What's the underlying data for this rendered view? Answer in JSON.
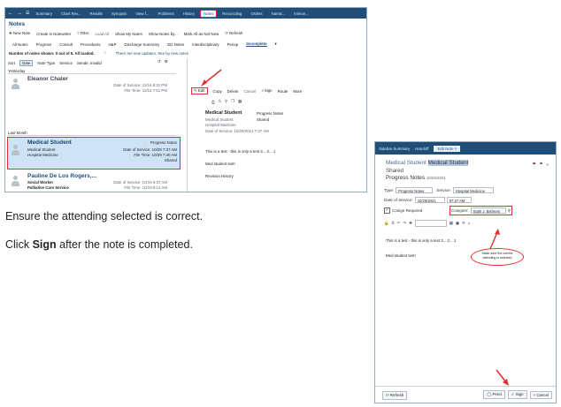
{
  "left_window": {
    "tabs": [
      "Summary",
      "Chart Rev...",
      "Results",
      "Synopsis",
      "View f...",
      "Problems",
      "History",
      "Notes",
      "Reconciling",
      "Orders",
      "Narrat...",
      "Immun..."
    ],
    "active_tab": "Notes",
    "title": "Notes",
    "toolbar": [
      "New Note",
      "Create in Notewriter",
      "Filter",
      "Load All",
      "Show My Notes",
      "Show Notes by...",
      "Mark All as Not New",
      "Refresh"
    ],
    "filter_tabs": [
      "All Notes",
      "Progress",
      "Consult",
      "Procedures",
      "H&P",
      "Discharge Summary",
      "ED Notes",
      "Interdisciplinary",
      "Periop",
      "Incomplete"
    ],
    "active_filter": "Incomplete",
    "status_text": "Number of notes shown: 0 out of 5.  All loaded.",
    "status_warning": "There are new updates. See by new notes",
    "sort_options": [
      "Sort",
      "Date",
      "Note Type",
      "Service",
      "Sende, Invalid"
    ],
    "groups": [
      "Yesterday",
      "Last Month"
    ],
    "notes": [
      {
        "name": "Eleanor Chaler",
        "role": "",
        "dept": "",
        "date_of_service": "Date of Service: 11/16 8:31 PM",
        "file_time": "File Time: 11/16 7:51 PM",
        "type": "",
        "status": ""
      },
      {
        "name": "Medical Student",
        "role": "Medical Student",
        "dept": "Hospital Medicine",
        "date_of_service": "Date of Service: 10/29 7:37 AM",
        "file_time": "File Time: 10/29 7:40 AM",
        "type": "Progress Notes",
        "status": "Shared"
      },
      {
        "name": "Pauline De Los Rogers,...",
        "role": "Social Worker",
        "dept": "Palliative Care Service",
        "date_of_service": "Date of Service: 10/19 6:37 AM",
        "file_time": "File Time: 10/19 8:12 AM",
        "type": "",
        "status": ""
      }
    ],
    "note_actions": [
      "Edit",
      "Copy",
      "Delete",
      "Cancel",
      "Sign",
      "Route",
      "More"
    ],
    "preview": {
      "author": "Medical Student",
      "author_role": "Medical Student",
      "author_dept": "Hospital Medicine",
      "note_type": "Progress Notes",
      "note_status": "Shared",
      "date_of_service": "Date of Service: 10/29/2021 7:37 AM",
      "body_line_1": "This is a test - this is only a test 3... 2... 1",
      "body_line_2": "Med student test!",
      "revision": "Revision History"
    }
  },
  "instructions": {
    "line1": "Ensure the attending selected is correct.",
    "line2_pre": "Click ",
    "line2_bold": "Sign",
    "line2_post": " after the note is completed."
  },
  "right_window": {
    "tabs": [
      "Sidebar Summary",
      "Handoff",
      "Edit Note"
    ],
    "active_tab": "Edit Note",
    "author_label": "Medical Student",
    "author_highlight": "Medical Student",
    "status": "Shared",
    "note_type": "Progress Notes",
    "note_date": "10/29/2021",
    "type_label": "Type:",
    "type_value": "Progress Notes",
    "service_label": "Service:",
    "service_value": "Hospital Medicine",
    "dos_label": "Date of Service:",
    "dos_date": "10/29/2021",
    "dos_time": "07:37 AM",
    "cosign_label": "Cosign Required",
    "cosigner_label": "Cosigner:",
    "cosigner_value": "Stahl J. Bishrem",
    "body_line_1": "This is a test - this is only a test 3... 2... 1",
    "body_line_2": "Med student test!",
    "callout": "Make sure the correct attending is selected",
    "bottom_left": "Refresh",
    "bottom_buttons": [
      "Pend",
      "Sign",
      "Cancel"
    ]
  },
  "colors": {
    "accent_red": "#e0302f",
    "nav_blue": "#1f4e79",
    "selection_blue": "#cfe3f7"
  }
}
